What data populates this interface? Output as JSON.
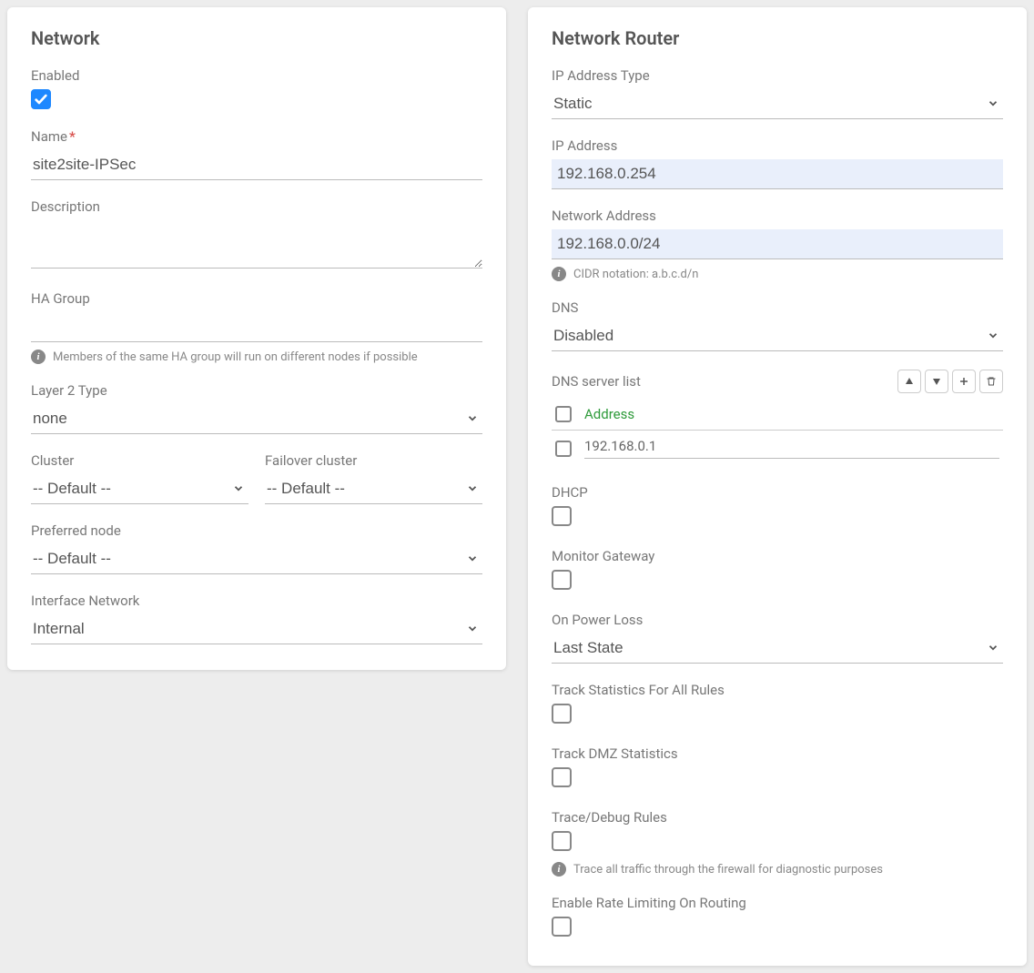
{
  "network": {
    "title": "Network",
    "enabled_label": "Enabled",
    "enabled": true,
    "name_label": "Name",
    "name_value": "site2site-IPSec",
    "description_label": "Description",
    "description_value": "",
    "ha_group_label": "HA Group",
    "ha_group_value": "",
    "ha_group_helper": "Members of the same HA group will run on different nodes if possible",
    "layer2_label": "Layer 2 Type",
    "layer2_value": "none",
    "cluster_label": "Cluster",
    "cluster_value": "-- Default --",
    "failover_cluster_label": "Failover cluster",
    "failover_cluster_value": "-- Default --",
    "preferred_node_label": "Preferred node",
    "preferred_node_value": "-- Default --",
    "interface_network_label": "Interface Network",
    "interface_network_value": "Internal"
  },
  "router": {
    "title": "Network Router",
    "ip_type_label": "IP Address Type",
    "ip_type_value": "Static",
    "ip_address_label": "IP Address",
    "ip_address_value": "192.168.0.254",
    "network_address_label": "Network Address",
    "network_address_value": "192.168.0.0/24",
    "cidr_helper": "CIDR notation: a.b.c.d/n",
    "dns_label": "DNS",
    "dns_value": "Disabled",
    "dns_server_list_label": "DNS server list",
    "dns_header": "Address",
    "dns_servers": [
      {
        "address": "192.168.0.1",
        "checked": false
      }
    ],
    "dhcp_label": "DHCP",
    "dhcp": false,
    "monitor_gateway_label": "Monitor Gateway",
    "monitor_gateway": false,
    "on_power_loss_label": "On Power Loss",
    "on_power_loss_value": "Last State",
    "track_stats_label": "Track Statistics For All Rules",
    "track_stats": false,
    "track_dmz_label": "Track DMZ Statistics",
    "track_dmz": false,
    "trace_debug_label": "Trace/Debug Rules",
    "trace_debug": false,
    "trace_helper": "Trace all traffic through the firewall for diagnostic purposes",
    "rate_limit_label": "Enable Rate Limiting On Routing",
    "rate_limit": false
  }
}
